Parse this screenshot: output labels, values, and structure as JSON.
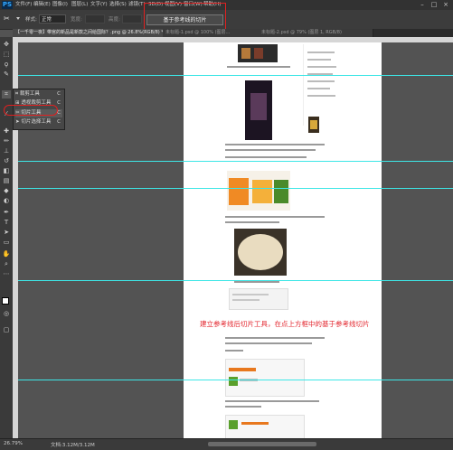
{
  "app": {
    "logo": "PS",
    "menus": [
      "文件(F)",
      "编辑(E)",
      "图像(I)",
      "图层(L)",
      "文字(Y)",
      "选择(S)",
      "滤镜(T)",
      "3D(D)",
      "视图(V)",
      "窗口(W)",
      "帮助(H)"
    ],
    "window_controls": [
      "–",
      "□",
      "×"
    ]
  },
  "options": {
    "style_label": "样式:",
    "style_value": "正常",
    "width_label": "宽度:",
    "height_label": "高度:",
    "slice_button_label": "基于参考线的切片"
  },
  "tabs": [
    {
      "label": "【一千零一夜】带宫的新品是新款之间给国际？.png @ 26.8%(RGB/8) *",
      "active": true
    },
    {
      "label": "未标题-1.psd @ 100% (图层...",
      "active": false
    },
    {
      "label": "未标题-2.psd @ 79% (图层 1, RGB/8)",
      "active": false
    }
  ],
  "flyout": {
    "items": [
      {
        "label": "裁剪工具",
        "shortcut": "C"
      },
      {
        "label": "透视裁剪工具",
        "shortcut": "C"
      },
      {
        "label": "切片工具",
        "shortcut": "C"
      },
      {
        "label": "切片选择工具",
        "shortcut": "C"
      }
    ],
    "selected_index": 2
  },
  "document": {
    "annotation": "建立参考线后切片工具，在点上方框中的基于参考线切片"
  },
  "status": {
    "zoom": "26.79%",
    "doc_size": "文档:3.12M/3.12M"
  },
  "colors": {
    "guide": "#3de6e6",
    "highlight": "#e02020",
    "annotation": "#e3262e"
  }
}
